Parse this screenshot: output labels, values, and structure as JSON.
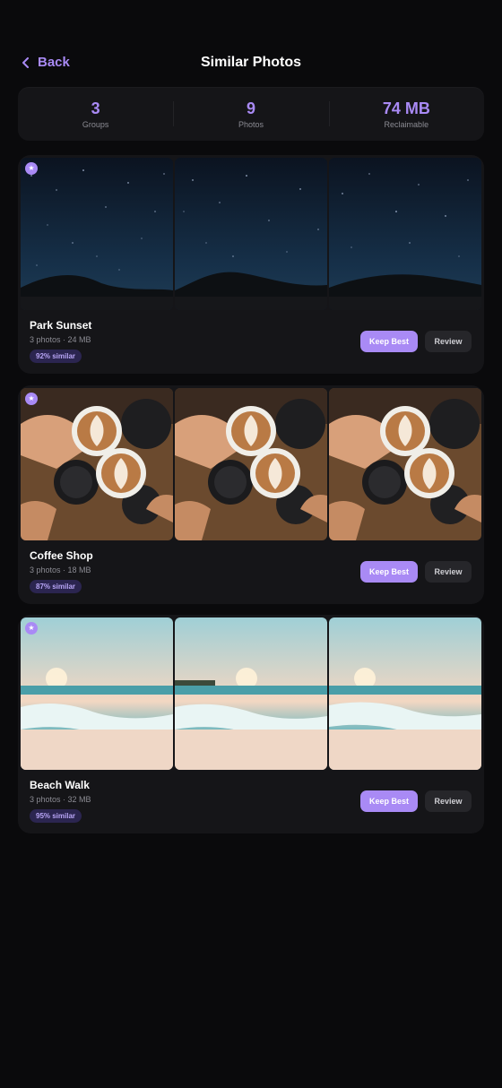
{
  "header": {
    "back_label": "Back",
    "title": "Similar Photos"
  },
  "stats": [
    {
      "value": "3",
      "label": "Groups"
    },
    {
      "value": "9",
      "label": "Photos"
    },
    {
      "value": "74 MB",
      "label": "Reclaimable"
    }
  ],
  "groups": [
    {
      "name": "Park Sunset",
      "meta": "3 photos · 24 MB",
      "similarity": "92% similar",
      "keep_label": "Keep Best",
      "review_label": "Review",
      "photo_type": "night-sky"
    },
    {
      "name": "Coffee Shop",
      "meta": "3 photos · 18 MB",
      "similarity": "87% similar",
      "keep_label": "Keep Best",
      "review_label": "Review",
      "photo_type": "coffee"
    },
    {
      "name": "Beach Walk",
      "meta": "3 photos · 32 MB",
      "similarity": "95% similar",
      "keep_label": "Keep Best",
      "review_label": "Review",
      "photo_type": "beach"
    }
  ],
  "colors": {
    "accent": "#a98af5",
    "background": "#0a0a0c",
    "card": "#151518"
  },
  "icons": {
    "back": "chevron-left-icon",
    "best": "star-icon"
  }
}
